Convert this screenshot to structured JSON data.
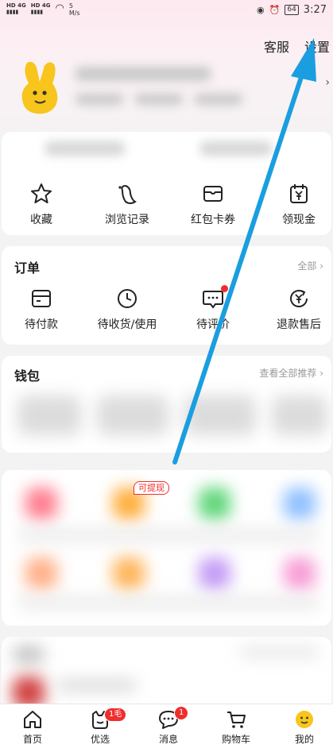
{
  "status_bar": {
    "sim1": "HD 4G",
    "sim2": "HD 4G",
    "net_speed": "5 M/s",
    "battery": "64",
    "time": "3:27"
  },
  "header": {
    "service_label": "客服",
    "settings_label": "设置"
  },
  "quick_links": [
    {
      "label": "收藏",
      "icon": "star-icon"
    },
    {
      "label": "浏览记录",
      "icon": "footprint-icon"
    },
    {
      "label": "红包卡券",
      "icon": "wallet-card-icon"
    },
    {
      "label": "领现金",
      "icon": "yen-calendar-icon"
    }
  ],
  "orders": {
    "title": "订单",
    "all_link": "全部",
    "items": [
      {
        "label": "待付款",
        "icon": "card-icon"
      },
      {
        "label": "待收货/使用",
        "icon": "clock-icon"
      },
      {
        "label": "待评价",
        "icon": "comment-icon"
      },
      {
        "label": "退款售后",
        "icon": "refund-icon"
      }
    ]
  },
  "wallet": {
    "title": "钱包",
    "more_link": "查看全部推荐"
  },
  "services": {
    "badge": "可提现"
  },
  "tabbar": {
    "items": [
      {
        "label": "首页",
        "icon": "home-icon"
      },
      {
        "label": "优选",
        "icon": "youxuan-icon",
        "badge": "1毛"
      },
      {
        "label": "消息",
        "icon": "message-icon",
        "badge": "1"
      },
      {
        "label": "购物车",
        "icon": "cart-icon"
      },
      {
        "label": "我的",
        "icon": "profile-face-icon"
      }
    ]
  },
  "colors": {
    "accent_red": "#f02d2d",
    "annotation_arrow": "#1a9ee0"
  }
}
